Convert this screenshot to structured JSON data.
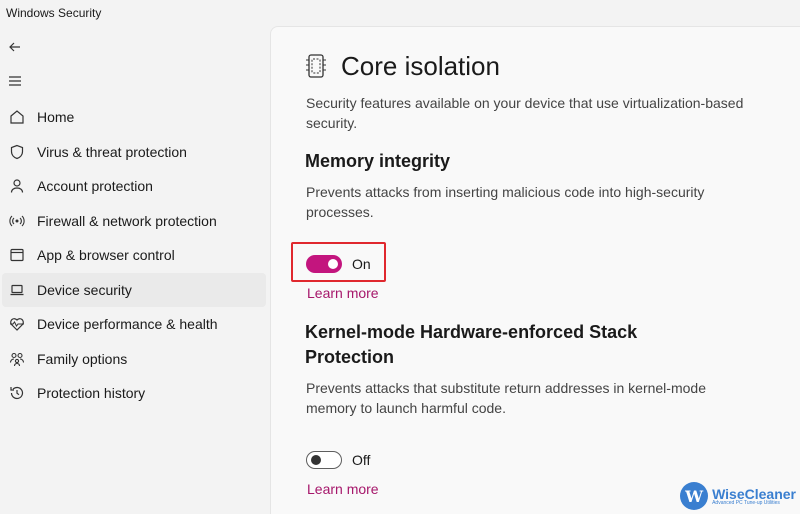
{
  "window": {
    "title": "Windows Security"
  },
  "sidebar": {
    "items": [
      {
        "label": "Home",
        "icon": "home-icon"
      },
      {
        "label": "Virus & threat protection",
        "icon": "shield-icon"
      },
      {
        "label": "Account protection",
        "icon": "person-icon"
      },
      {
        "label": "Firewall & network protection",
        "icon": "wifi-antenna-icon"
      },
      {
        "label": "App & browser control",
        "icon": "app-window-icon"
      },
      {
        "label": "Device security",
        "icon": "laptop-icon",
        "active": true
      },
      {
        "label": "Device performance & health",
        "icon": "heart-pulse-icon"
      },
      {
        "label": "Family options",
        "icon": "family-icon"
      },
      {
        "label": "Protection history",
        "icon": "history-icon"
      }
    ]
  },
  "page": {
    "title": "Core isolation",
    "description": "Security features available on your device that use virtualization-based security.",
    "memory_integrity": {
      "title": "Memory integrity",
      "description": "Prevents attacks from inserting malicious code into high-security processes.",
      "toggle_label": "On",
      "learn_more": "Learn more"
    },
    "kernel_stack": {
      "title": "Kernel-mode Hardware-enforced Stack Protection",
      "description": "Prevents attacks that substitute return addresses in kernel-mode memory to launch harmful code.",
      "toggle_label": "Off",
      "learn_more": "Learn more"
    }
  },
  "watermark": {
    "logo_letter": "W",
    "name": "WiseCleaner",
    "tagline": "Advanced PC Tune-up Utilities"
  },
  "colors": {
    "accent": "#c3157e",
    "link": "#a6176b",
    "highlight": "#e0282e",
    "watermark": "#3a7fd0"
  }
}
